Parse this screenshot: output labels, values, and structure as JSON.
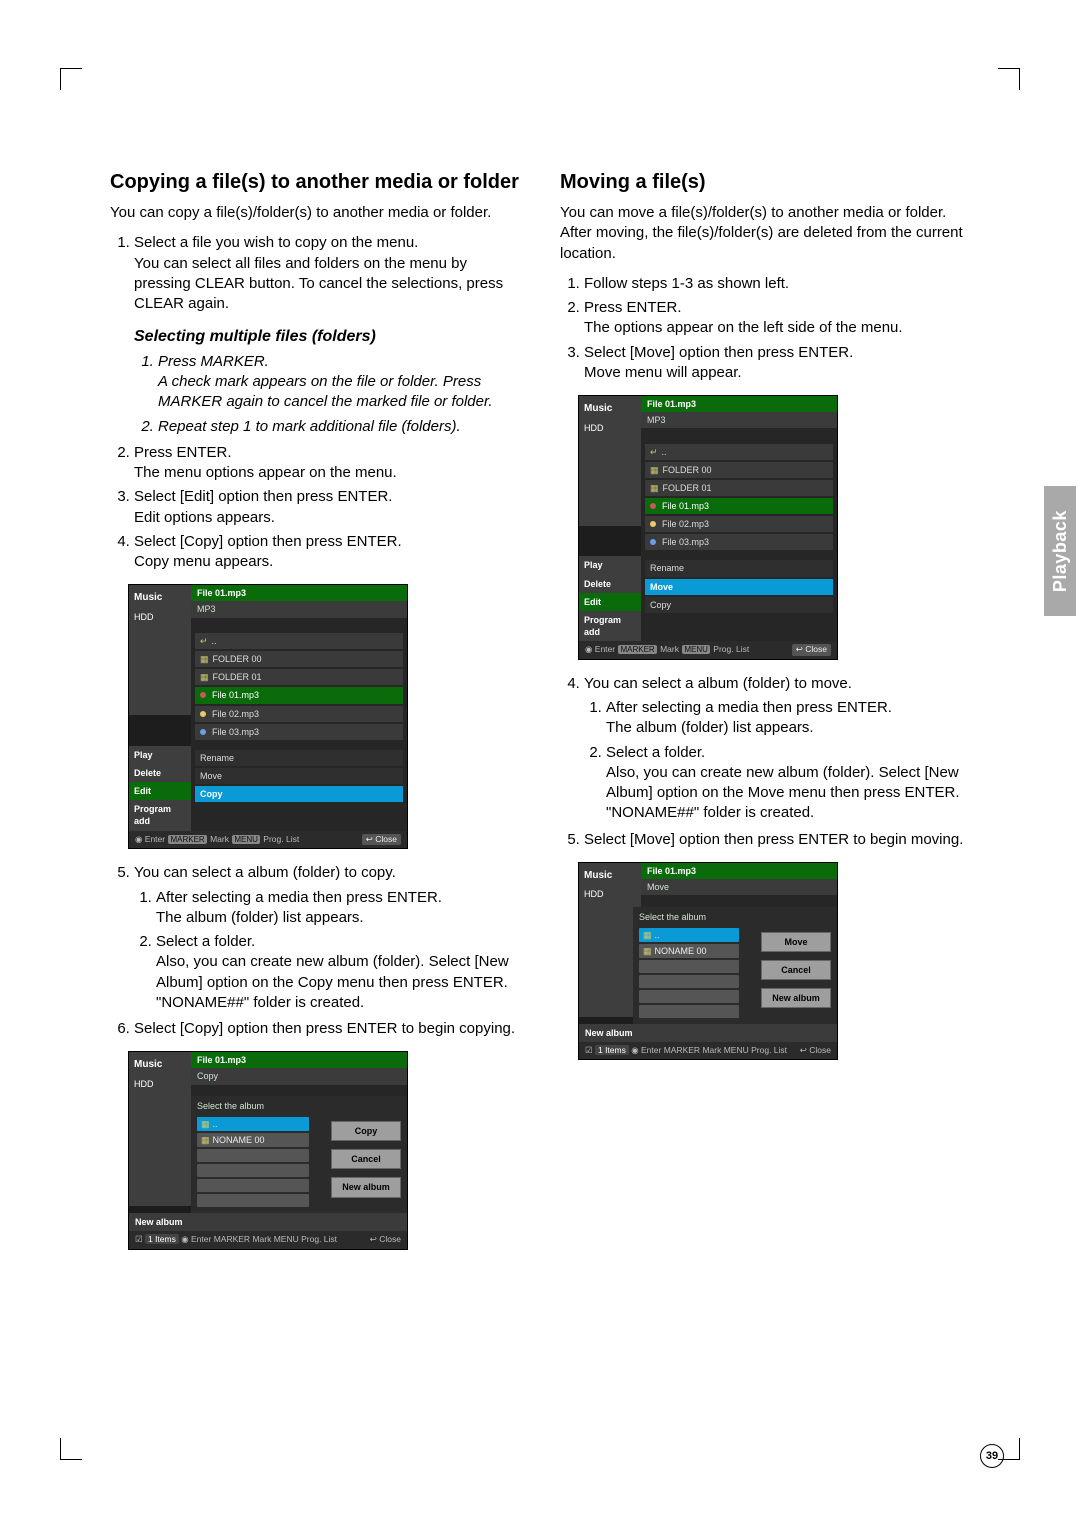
{
  "side_tab": "Playback",
  "page_number": "39",
  "left": {
    "h2": "Copying a file(s) to another media or folder",
    "intro": "You can copy a file(s)/folder(s) to another media or folder.",
    "step1a": "Select a file you wish to copy on the menu.",
    "step1b": "You can select all files and folders on the menu by pressing CLEAR button. To cancel the selections, press CLEAR again.",
    "h3": "Selecting multiple files (folders)",
    "sub1a": "Press MARKER.",
    "sub1b": "A check mark appears on the file or folder. Press MARKER again to cancel the marked file or folder.",
    "sub2": "Repeat step 1 to mark additional file (folders).",
    "step2a": "Press ENTER.",
    "step2b": "The menu options appear on the menu.",
    "step3a": "Select [Edit] option then press ENTER.",
    "step3b": "Edit options appears.",
    "step4a": "Select [Copy] option then press ENTER.",
    "step4b": "Copy menu appears.",
    "step5": "You can select a album (folder) to copy.",
    "step5_1a": "After selecting a media then press ENTER.",
    "step5_1b": "The album (folder) list appears.",
    "step5_2a": "Select a folder.",
    "step5_2b": "Also, you can create new album (folder). Select [New Album] option on the Copy menu then press ENTER.",
    "step5_2c": "\"NONAME##\" folder is created.",
    "step6": "Select [Copy] option then press ENTER to begin copying."
  },
  "right": {
    "h2": "Moving a file(s)",
    "intro": "You can move a file(s)/folder(s) to another media or folder. After moving, the file(s)/folder(s) are deleted from the current location.",
    "step1": "Follow steps 1-3 as shown left.",
    "step2a": "Press ENTER.",
    "step2b": "The options appear on the left side of the menu.",
    "step3a": "Select [Move] option then press ENTER.",
    "step3b": "Move menu will appear.",
    "step4": "You can select a album (folder) to move.",
    "step4_1a": "After selecting a media then press ENTER.",
    "step4_1b": "The album (folder) list appears.",
    "step4_2a": "Select a folder.",
    "step4_2b": "Also, you can create new album (folder). Select [New Album] option on the Move menu then press ENTER.",
    "step4_2c": "\"NONAME##\" folder is created.",
    "step5": "Select [Move] option then press ENTER to begin moving."
  },
  "shot_common": {
    "music": "Music",
    "hdd": "HDD",
    "file": "File 01.mp3",
    "mp3": "MP3",
    "up": "..",
    "folder00": "FOLDER 00",
    "folder01": "FOLDER 01",
    "file01": "File 01.mp3",
    "file02": "File 02.mp3",
    "file03": "File 03.mp3",
    "play": "Play",
    "delete": "Delete",
    "edit": "Edit",
    "program_add": "Program add",
    "rename": "Rename",
    "move": "Move",
    "copy": "Copy",
    "enter": "Enter",
    "mark": "Mark",
    "proglist": "Prog. List",
    "close": "Close",
    "marker": "MARKER",
    "menu": "MENU"
  },
  "shot_picker": {
    "select_album": "Select the album",
    "noname": "NONAME 00",
    "new_album": "New album",
    "items": "1 Items",
    "cancel": "Cancel",
    "copy_btn": "Copy",
    "move_btn": "Move",
    "copy_title": "Copy",
    "move_title": "Move"
  }
}
